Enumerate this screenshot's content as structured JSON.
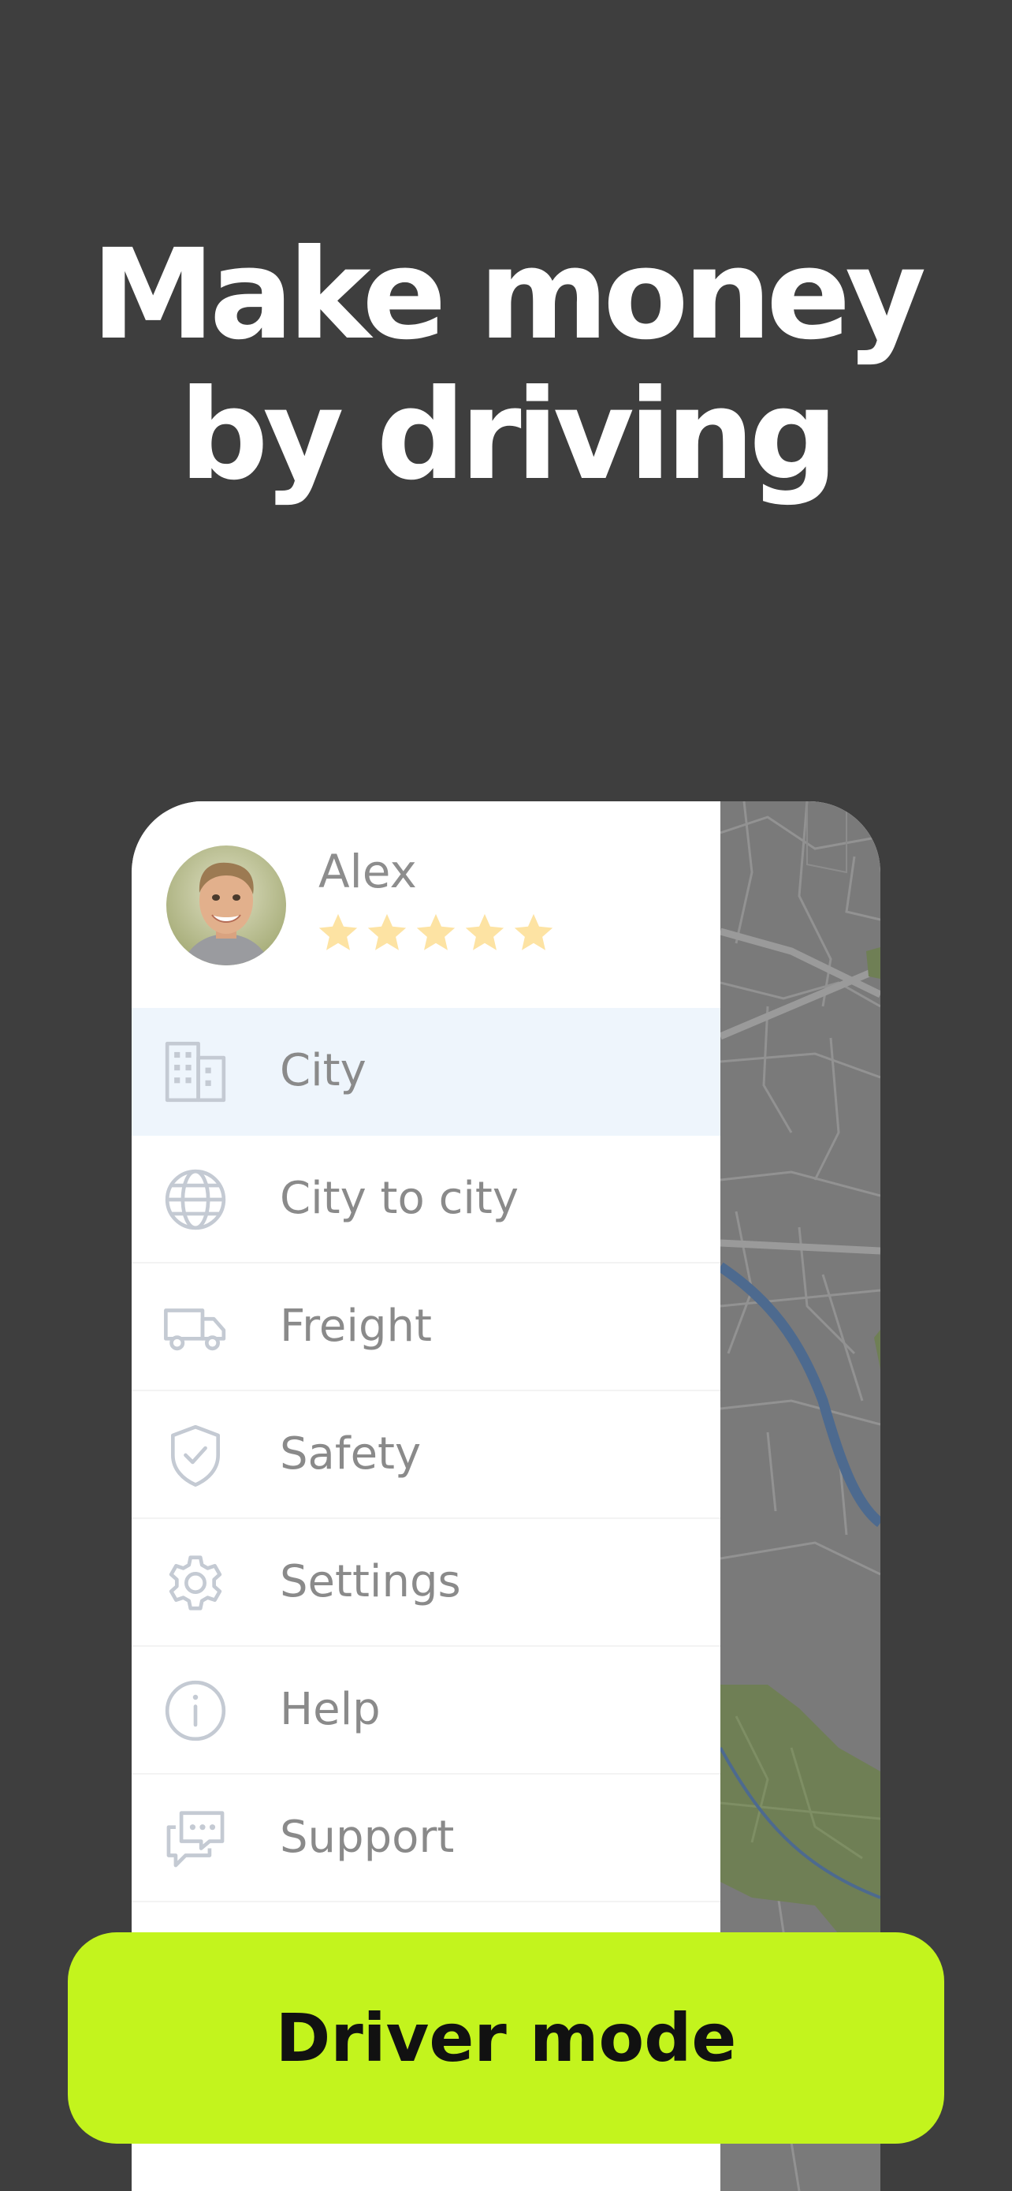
{
  "headline": {
    "line1": "Make money",
    "line2": "by driving"
  },
  "profile": {
    "name": "Alex",
    "rating_stars": 5,
    "star_color": "#fde3a3"
  },
  "menu": {
    "items": [
      {
        "label": "City",
        "icon": "building-icon",
        "active": true
      },
      {
        "label": "City to city",
        "icon": "globe-icon",
        "active": false
      },
      {
        "label": "Freight",
        "icon": "truck-icon",
        "active": false
      },
      {
        "label": "Safety",
        "icon": "shield-check-icon",
        "active": false
      },
      {
        "label": "Settings",
        "icon": "gear-icon",
        "active": false
      },
      {
        "label": "Help",
        "icon": "info-icon",
        "active": false
      },
      {
        "label": "Support",
        "icon": "chat-icon",
        "active": false
      }
    ]
  },
  "cta": {
    "label": "Driver mode"
  },
  "colors": {
    "background": "#3e3e3e",
    "accent": "#c3f41d",
    "active_row": "#eef5fc",
    "icon": "#c4cad3"
  }
}
